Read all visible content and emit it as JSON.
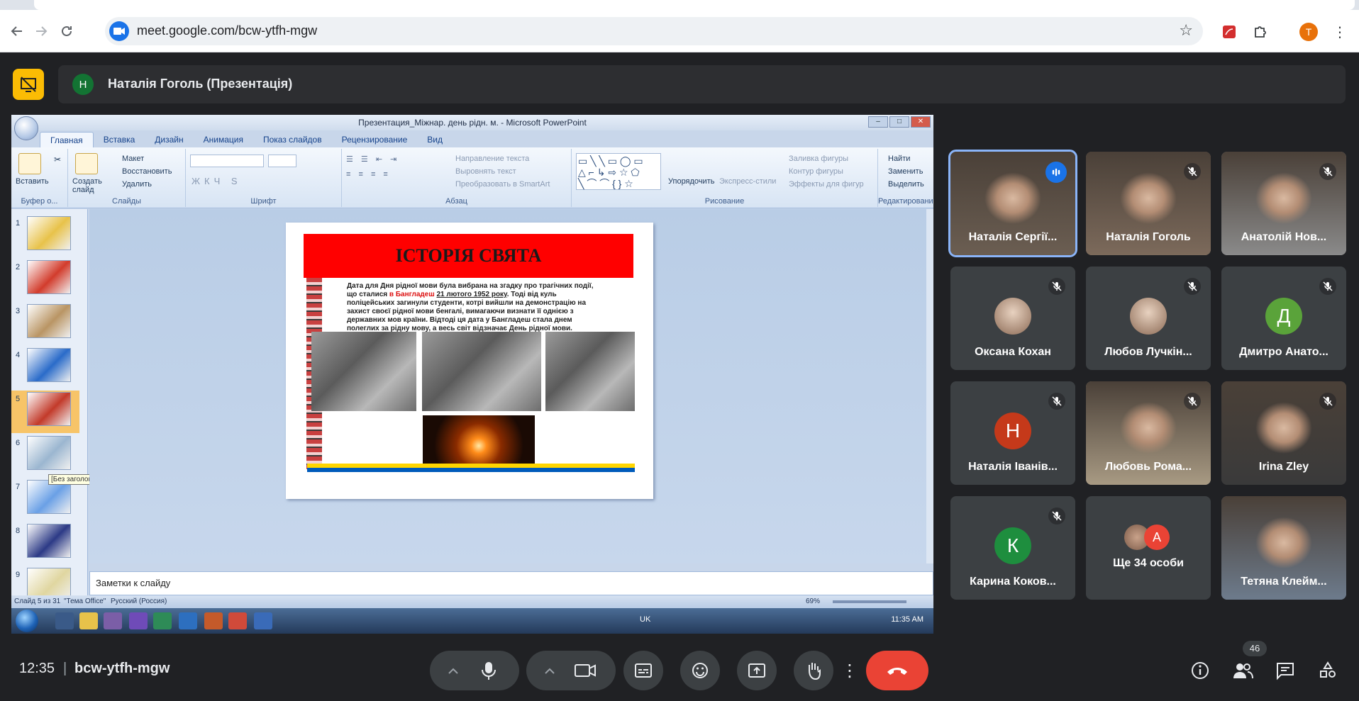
{
  "browser": {
    "url": "meet.google.com/bcw-ytfh-mgw",
    "profile_initial": "T",
    "colors": {
      "accent": "#1a73e8",
      "profile": "#e8710a"
    }
  },
  "presentation": {
    "presenter_initial": "Н",
    "title": "Наталія Гоголь (Презентація)"
  },
  "powerpoint": {
    "window_title": "Презентация_Міжнар. день рідн. м. - Microsoft PowerPoint",
    "tabs": [
      "Главная",
      "Вставка",
      "Дизайн",
      "Анимация",
      "Показ слайдов",
      "Рецензирование",
      "Вид"
    ],
    "ribbon": {
      "clipboard": {
        "paste": "Вставить",
        "label": "Буфер о..."
      },
      "slides": {
        "create": "Создать слайд",
        "layout": "Макет",
        "reset": "Восстановить",
        "delete": "Удалить",
        "label": "Слайды"
      },
      "font": {
        "label": "Шрифт"
      },
      "paragraph": {
        "text_dir": "Направление текста",
        "align_text": "Выровнять текст",
        "smartart": "Преобразовать в SmartArt",
        "label": "Абзац"
      },
      "drawing": {
        "arrange": "Упорядочить",
        "quick_styles": "Экспресс-стили",
        "fill": "Заливка фигуры",
        "outline": "Контур фигуры",
        "effects": "Эффекты для фигур",
        "label": "Рисование"
      },
      "editing": {
        "find": "Найти",
        "replace": "Заменить",
        "select": "Выделить",
        "label": "Редактирование"
      }
    },
    "thumbnails": [
      {
        "num": "1",
        "color": "#e8c24a"
      },
      {
        "num": "2",
        "color": "#d23c2c"
      },
      {
        "num": "3",
        "color": "#b99564"
      },
      {
        "num": "4",
        "color": "#2a6bc9"
      },
      {
        "num": "5",
        "color": "#c23a2a"
      },
      {
        "num": "6",
        "color": "#9bb6d0"
      },
      {
        "num": "7",
        "color": "#6aa0e6"
      },
      {
        "num": "8",
        "color": "#2c3a86"
      },
      {
        "num": "9",
        "color": "#e0d6a0"
      }
    ],
    "tooltip": "[Без заголовка]",
    "slide": {
      "title": "ІСТОРІЯ СВЯТА",
      "text_1": "Дата для Дня рідної мови була вибрана на згадку про трагічних події, що сталися ",
      "text_red": "в Бангладеш ",
      "text_ul": "21 лютого 1952 року",
      "text_2": ". Тоді від куль поліцейських загинули студенти, котрі вийшли на демонстрацію на захист своєї рідної мови бенгалі, вимагаючи визнати її однією з державних мов країни. Відтоді ця дата у Бангладеш стала днем полеглих за рідну мову, а весь світ відзначає День рідної мови."
    },
    "notes_placeholder": "Заметки к слайду",
    "status": {
      "slide": "Слайд 5 из 31",
      "theme": "\"Тема Office\"",
      "lang": "Русский (Россия)",
      "zoom": "69%"
    },
    "taskbar": {
      "lang": "UK",
      "clock": "11:35 AM"
    }
  },
  "participants": [
    {
      "name": "Наталія Сергії...",
      "kind": "video",
      "speaking": true
    },
    {
      "name": "Наталія Гоголь",
      "kind": "video",
      "muted": true
    },
    {
      "name": "Анатолій Нов...",
      "kind": "video",
      "muted": true
    },
    {
      "name": "Оксана Кохан",
      "kind": "photo",
      "muted": true
    },
    {
      "name": "Любов Лучкін...",
      "kind": "photo",
      "muted": true
    },
    {
      "name": "Дмитро Анато...",
      "kind": "letter",
      "letter": "Д",
      "color": "#5aa33a",
      "muted": true
    },
    {
      "name": "Наталія Іванів...",
      "kind": "letter",
      "letter": "Н",
      "color": "#c5391a",
      "muted": true
    },
    {
      "name": "Любовь Рома...",
      "kind": "video",
      "muted": true
    },
    {
      "name": "Irina Zley",
      "kind": "video",
      "muted": true
    },
    {
      "name": "Карина Коков...",
      "kind": "letter",
      "letter": "К",
      "color": "#1e8e3e",
      "muted": true
    },
    {
      "name": "Ще 34 особи",
      "kind": "more",
      "letter": "A"
    },
    {
      "name": "Тетяна Клейм...",
      "kind": "video"
    }
  ],
  "bottom": {
    "time": "12:35",
    "separator": "|",
    "code": "bcw-ytfh-mgw",
    "people_count": "46",
    "colors": {
      "end_call": "#ea4335"
    }
  }
}
